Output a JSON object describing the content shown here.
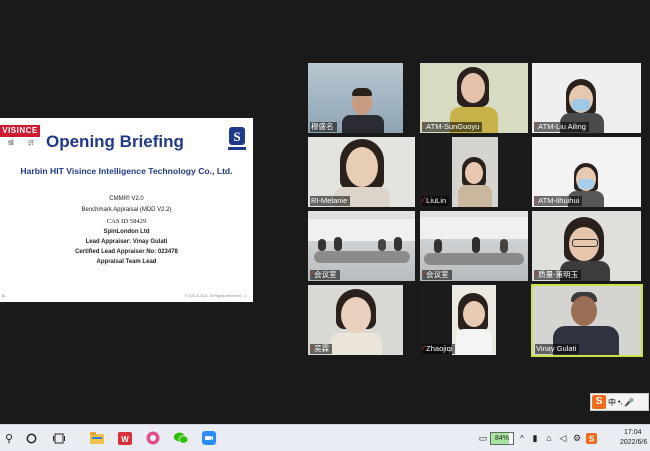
{
  "slide": {
    "logo_text": "VISINCE",
    "logo_sub": "维 识",
    "title": "Opening Briefing",
    "company": "Harbin HIT Visince Intelligence Technology Co., Ltd.",
    "lines": [
      "CMMI® V2.0",
      "Benchmark Appraisal (MDD V2.2)",
      "CAS ID 58429",
      "SpinLondon Ltd",
      "Lead Appraiser: Vinay Gulati",
      "Certified Lead Appraiser No: 023478",
      "Appraisal Team Lead"
    ],
    "footer": "© ISACA 2021. All Rights Reserved.  |  1",
    "footmark": "A"
  },
  "participants": [
    {
      "name": "穆盛名",
      "muted": false
    },
    {
      "name": "ATM-SunGuoyu",
      "muted": true
    },
    {
      "name": "ATM-Liu Ailing",
      "muted": true
    },
    {
      "name": "RI-Melanie",
      "muted": false
    },
    {
      "name": "LiuLin",
      "muted": true
    },
    {
      "name": "ATM-lihuihui",
      "muted": true
    },
    {
      "name": "会议室",
      "muted": true
    },
    {
      "name": "会议室",
      "muted": true
    },
    {
      "name": "质量-董明玉",
      "muted": true
    },
    {
      "name": "吴霖",
      "muted": true
    },
    {
      "name": "Zhaojiqi",
      "muted": true
    },
    {
      "name": "Vinay Gulati",
      "muted": false
    }
  ],
  "ime": {
    "logo": "S",
    "mode": "中"
  },
  "taskbar": {
    "battery": "84%",
    "time": "17:04",
    "date": "2022/6/6"
  },
  "colors": {
    "active_speaker": "#c9e24a",
    "muted_mic": "#e53935",
    "slide_title": "#1f3a88",
    "brand_red": "#d1192f"
  }
}
